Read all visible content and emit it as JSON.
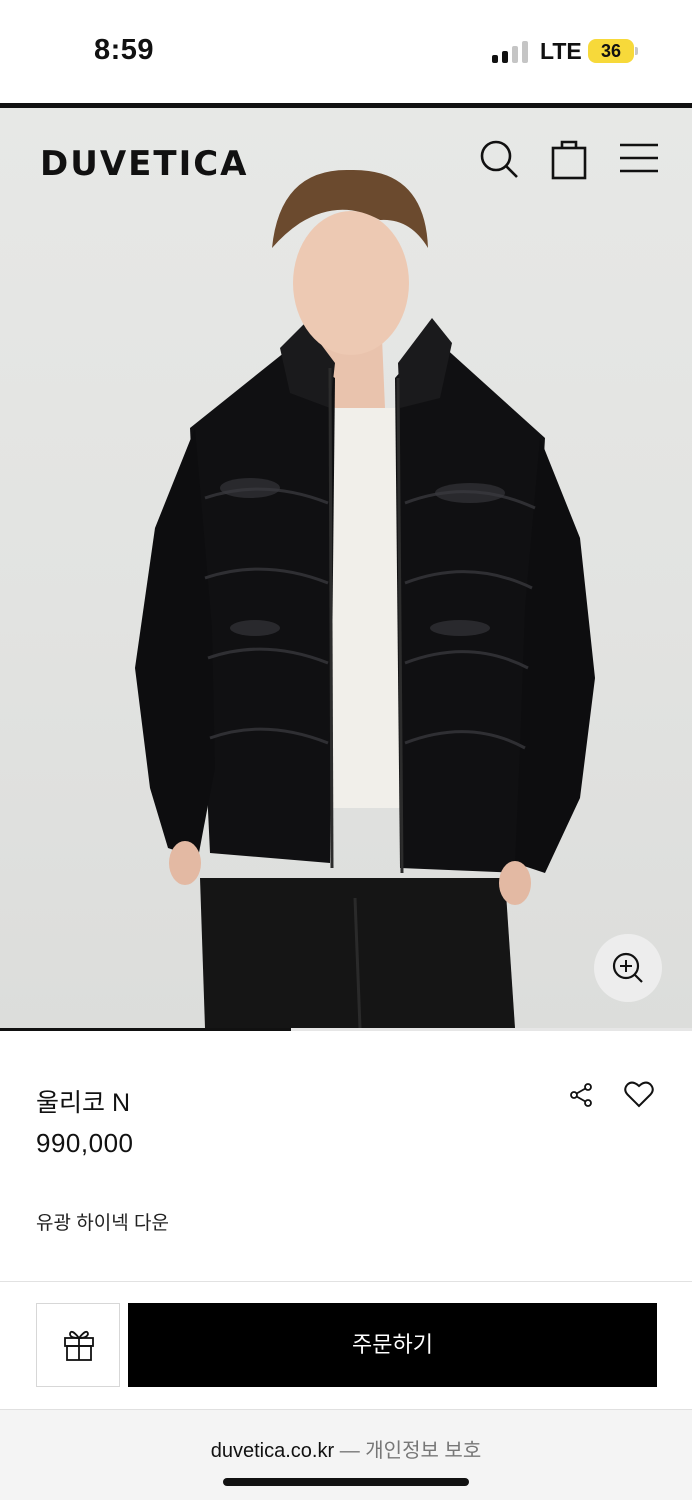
{
  "status_bar": {
    "time": "8:59",
    "network": "LTE",
    "battery": "36",
    "signal_bars_active": 2,
    "signal_bars_total": 4,
    "battery_color": "#f7d93a"
  },
  "header": {
    "brand": "DUVETICA",
    "icons": [
      "search-icon",
      "shopping-bag-icon",
      "menu-icon"
    ]
  },
  "hero": {
    "image_description_icon": "product-photo",
    "zoom_icon": "zoom-in-icon",
    "gallery_progress": 0.42
  },
  "product": {
    "name": "울리코 N",
    "price": "990,000",
    "description": "유광 하이넥 다운",
    "actions": [
      "share-icon",
      "heart-icon"
    ]
  },
  "actions": {
    "gift_icon": "gift-icon",
    "order_label": "주문하기"
  },
  "browser": {
    "host": "duvetica.co.kr",
    "separator": " — ",
    "page_title": "개인정보 보호"
  },
  "colors": {
    "primary": "#000000",
    "accent_battery": "#f7d93a"
  }
}
